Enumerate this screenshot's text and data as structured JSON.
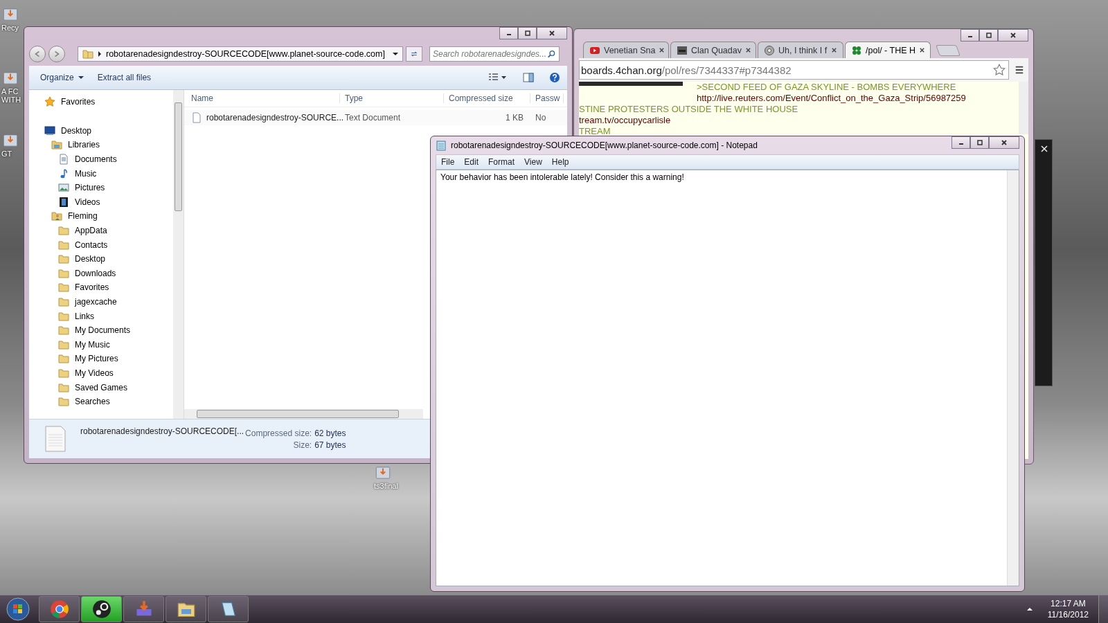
{
  "desktop_icons": [
    {
      "label": "Recy"
    },
    {
      "label": "A FC WITH"
    },
    {
      "label": "GT"
    },
    {
      "label": "ts3final"
    }
  ],
  "browser": {
    "tabs": [
      {
        "label": "Venetian Sna",
        "kind": "video",
        "selected": false
      },
      {
        "label": "Clan Quadav",
        "kind": "thumb",
        "selected": false
      },
      {
        "label": "Uh, I think I f",
        "kind": "gear",
        "selected": false
      },
      {
        "label": "/pol/ - THE H",
        "kind": "clover",
        "selected": true
      }
    ],
    "address": {
      "host": "boards.4chan.org",
      "path": "/pol/res/7344337#p7344382"
    },
    "right_column_lines": [
      {
        "kind": "greentext",
        "text": ">SECOND FEED OF GAZA SKYLINE - BOMBS EVERYWHERE"
      },
      {
        "kind": "link",
        "text": "http://live.reuters.com/Event/Conflict_on_the_Gaza_Strip/56987259"
      }
    ],
    "lines": [
      {
        "kind": "greentext",
        "text": "STINE PROTESTERS OUTSIDE THE WHITE HOUSE"
      },
      {
        "kind": "link",
        "text": "tream.tv/occupycarlisle"
      },
      {
        "kind": "greentext",
        "text": "TREAM"
      }
    ]
  },
  "explorer": {
    "address": "robotarenadesigndestroy-SOURCECODE[www.planet-source-code.com]",
    "search": {
      "placeholder": "Search robotarenadesigndes..."
    },
    "toolbar": [
      {
        "label": "Organize",
        "has_menu": true
      },
      {
        "label": "Extract all files",
        "has_menu": false
      }
    ],
    "columns": [
      "Name",
      "Type",
      "Compressed size",
      "Passw"
    ],
    "files": [
      {
        "name": "robotarenadesigndestroy-SOURCE...",
        "type": "Text Document",
        "compressed_size": "1 KB",
        "password_protected": "No"
      }
    ],
    "sidebar": [
      {
        "label": "Favorites",
        "kind": "star"
      },
      {
        "label": "Desktop",
        "kind": "desktop",
        "children": [
          {
            "label": "Libraries",
            "kind": "library",
            "children": [
              {
                "label": "Documents",
                "kind": "document"
              },
              {
                "label": "Music",
                "kind": "music"
              },
              {
                "label": "Pictures",
                "kind": "picture"
              },
              {
                "label": "Videos",
                "kind": "video"
              }
            ]
          },
          {
            "label": "Fleming",
            "kind": "user",
            "children": [
              {
                "label": "AppData",
                "kind": "folder"
              },
              {
                "label": "Contacts",
                "kind": "folder"
              },
              {
                "label": "Desktop",
                "kind": "folder"
              },
              {
                "label": "Downloads",
                "kind": "folder"
              },
              {
                "label": "Favorites",
                "kind": "folder"
              },
              {
                "label": "jagexcache",
                "kind": "folder"
              },
              {
                "label": "Links",
                "kind": "folder"
              },
              {
                "label": "My Documents",
                "kind": "folder"
              },
              {
                "label": "My Music",
                "kind": "folder"
              },
              {
                "label": "My Pictures",
                "kind": "folder"
              },
              {
                "label": "My Videos",
                "kind": "folder"
              },
              {
                "label": "Saved Games",
                "kind": "folder"
              },
              {
                "label": "Searches",
                "kind": "folder"
              }
            ]
          }
        ]
      }
    ],
    "details": {
      "name": "robotarenadesigndestroy-SOURCECODE[...",
      "compressed_size_label": "Compressed size:",
      "compressed_size": "62 bytes",
      "size_label": "Size:",
      "size": "67 bytes"
    }
  },
  "notepad": {
    "title": "robotarenadesigndestroy-SOURCECODE[www.planet-source-code.com] - Notepad",
    "menu": [
      "File",
      "Edit",
      "Format",
      "View",
      "Help"
    ],
    "text": "Your behavior has been intolerable lately! Consider this a warning!"
  },
  "taskbar": {
    "buttons": [
      {
        "kind": "chrome",
        "highlighted": false
      },
      {
        "kind": "steam",
        "highlighted": true
      },
      {
        "kind": "installer",
        "highlighted": false
      },
      {
        "kind": "explorer",
        "highlighted": false
      },
      {
        "kind": "notepad",
        "highlighted": false
      }
    ],
    "time": "12:17 AM",
    "date": "11/16/2012"
  }
}
